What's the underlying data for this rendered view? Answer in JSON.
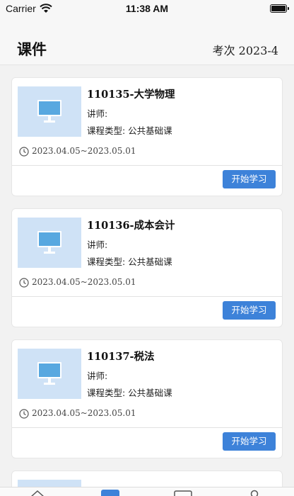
{
  "status_bar": {
    "carrier": "Carrier",
    "time": "11:38 AM"
  },
  "header": {
    "title": "课件",
    "exam_period": "考次 2023-4"
  },
  "cards": [
    {
      "title": "110135-大学物理",
      "teacher_label": "讲师:",
      "course_type": "课程类型:  公共基础课",
      "date_range": "2023.04.05~2023.05.01",
      "button_label": "开始学习"
    },
    {
      "title": "110136-成本会计",
      "teacher_label": "讲师:",
      "course_type": "课程类型:  公共基础课",
      "date_range": "2023.04.05~2023.05.01",
      "button_label": "开始学习"
    },
    {
      "title": "110137-税法",
      "teacher_label": "讲师:",
      "course_type": "课程类型:  公共基础课",
      "date_range": "2023.04.05~2023.05.01",
      "button_label": "开始学习"
    }
  ],
  "colors": {
    "accent": "#3d82d9",
    "thumb_bg": "#cfe2f6"
  }
}
